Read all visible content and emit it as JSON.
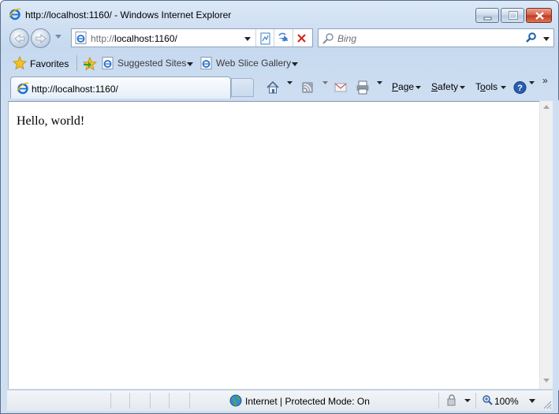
{
  "window": {
    "title": "http://localhost:1160/ - Windows Internet Explorer"
  },
  "address": {
    "url_prefix": "http://",
    "url_host": "localhost:1160/"
  },
  "search": {
    "placeholder": "Bing"
  },
  "favorites_bar": {
    "favorites_label": "Favorites",
    "items": [
      {
        "label": "Suggested Sites"
      },
      {
        "label": "Web Slice Gallery"
      }
    ]
  },
  "tab": {
    "label": "http://localhost:1160/"
  },
  "command_bar": {
    "page_label_pre": "",
    "page_label_u": "P",
    "page_label_post": "age",
    "safety_label_u": "S",
    "safety_label_post": "afety",
    "tools_label_pre": "T",
    "tools_label_u": "o",
    "tools_label_post": "ols",
    "overflow": "»"
  },
  "page": {
    "body_text": "Hello, world!"
  },
  "status": {
    "zone_text": "Internet | Protected Mode: On",
    "zoom_text": "100%"
  },
  "icons": {
    "ie_logo": "ie-logo-icon",
    "back": "back-arrow-icon",
    "forward": "forward-arrow-icon",
    "compat": "compatibility-view-icon",
    "refresh": "refresh-icon",
    "stop": "stop-icon",
    "search": "search-icon",
    "favorites": "favorites-star-icon",
    "add_favorites": "add-favorites-icon",
    "home": "home-icon",
    "feeds": "feeds-icon",
    "mail": "read-mail-icon",
    "print": "print-icon",
    "help": "help-icon",
    "globe": "internet-globe-icon"
  },
  "colors": {
    "frame": "#c6d9ef",
    "close_button": "#c2381f",
    "link_blue": "#1d5fb0"
  }
}
